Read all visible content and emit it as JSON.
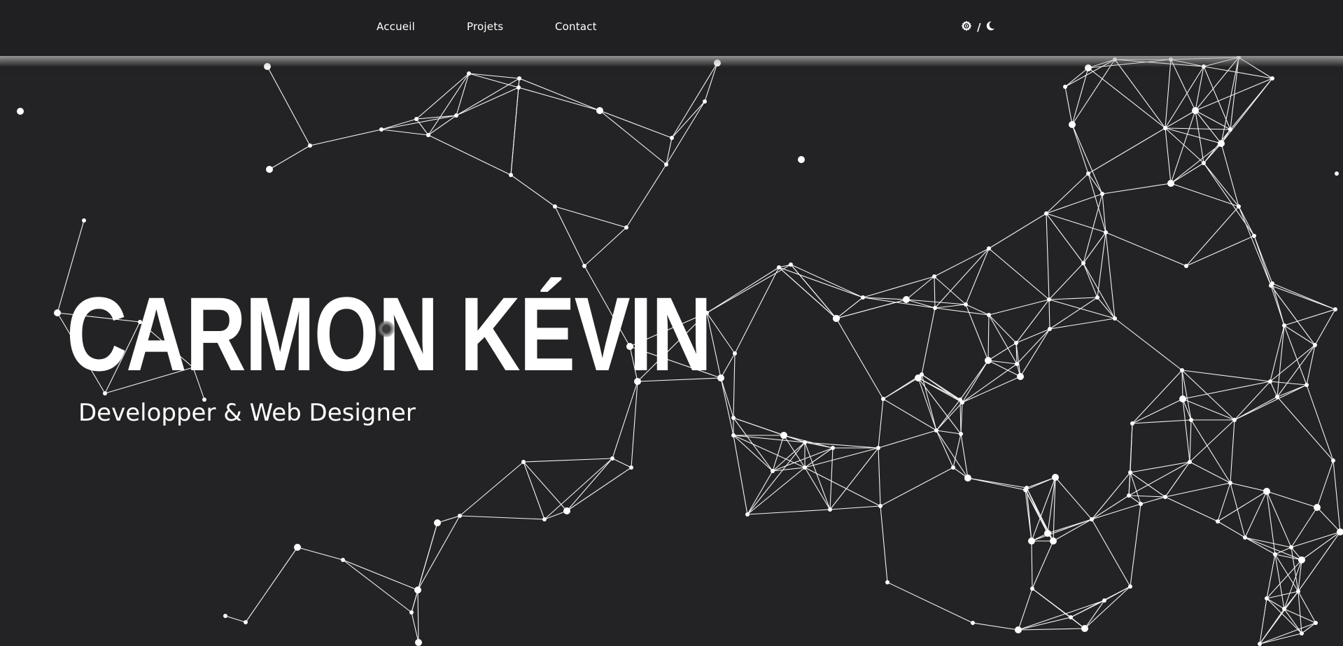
{
  "nav": {
    "links": [
      {
        "label": "Accueil"
      },
      {
        "label": "Projets"
      },
      {
        "label": "Contact"
      }
    ],
    "theme_toggle": {
      "separator": "/",
      "icons": [
        "gear-icon",
        "moon-icon"
      ]
    }
  },
  "hero": {
    "title": "CARMON KÉVIN",
    "subtitle": "Developper & Web Designer"
  },
  "colors": {
    "background": "#232325",
    "navbar": "#202022",
    "text": "#ffffff",
    "network": "#ffffff"
  }
}
